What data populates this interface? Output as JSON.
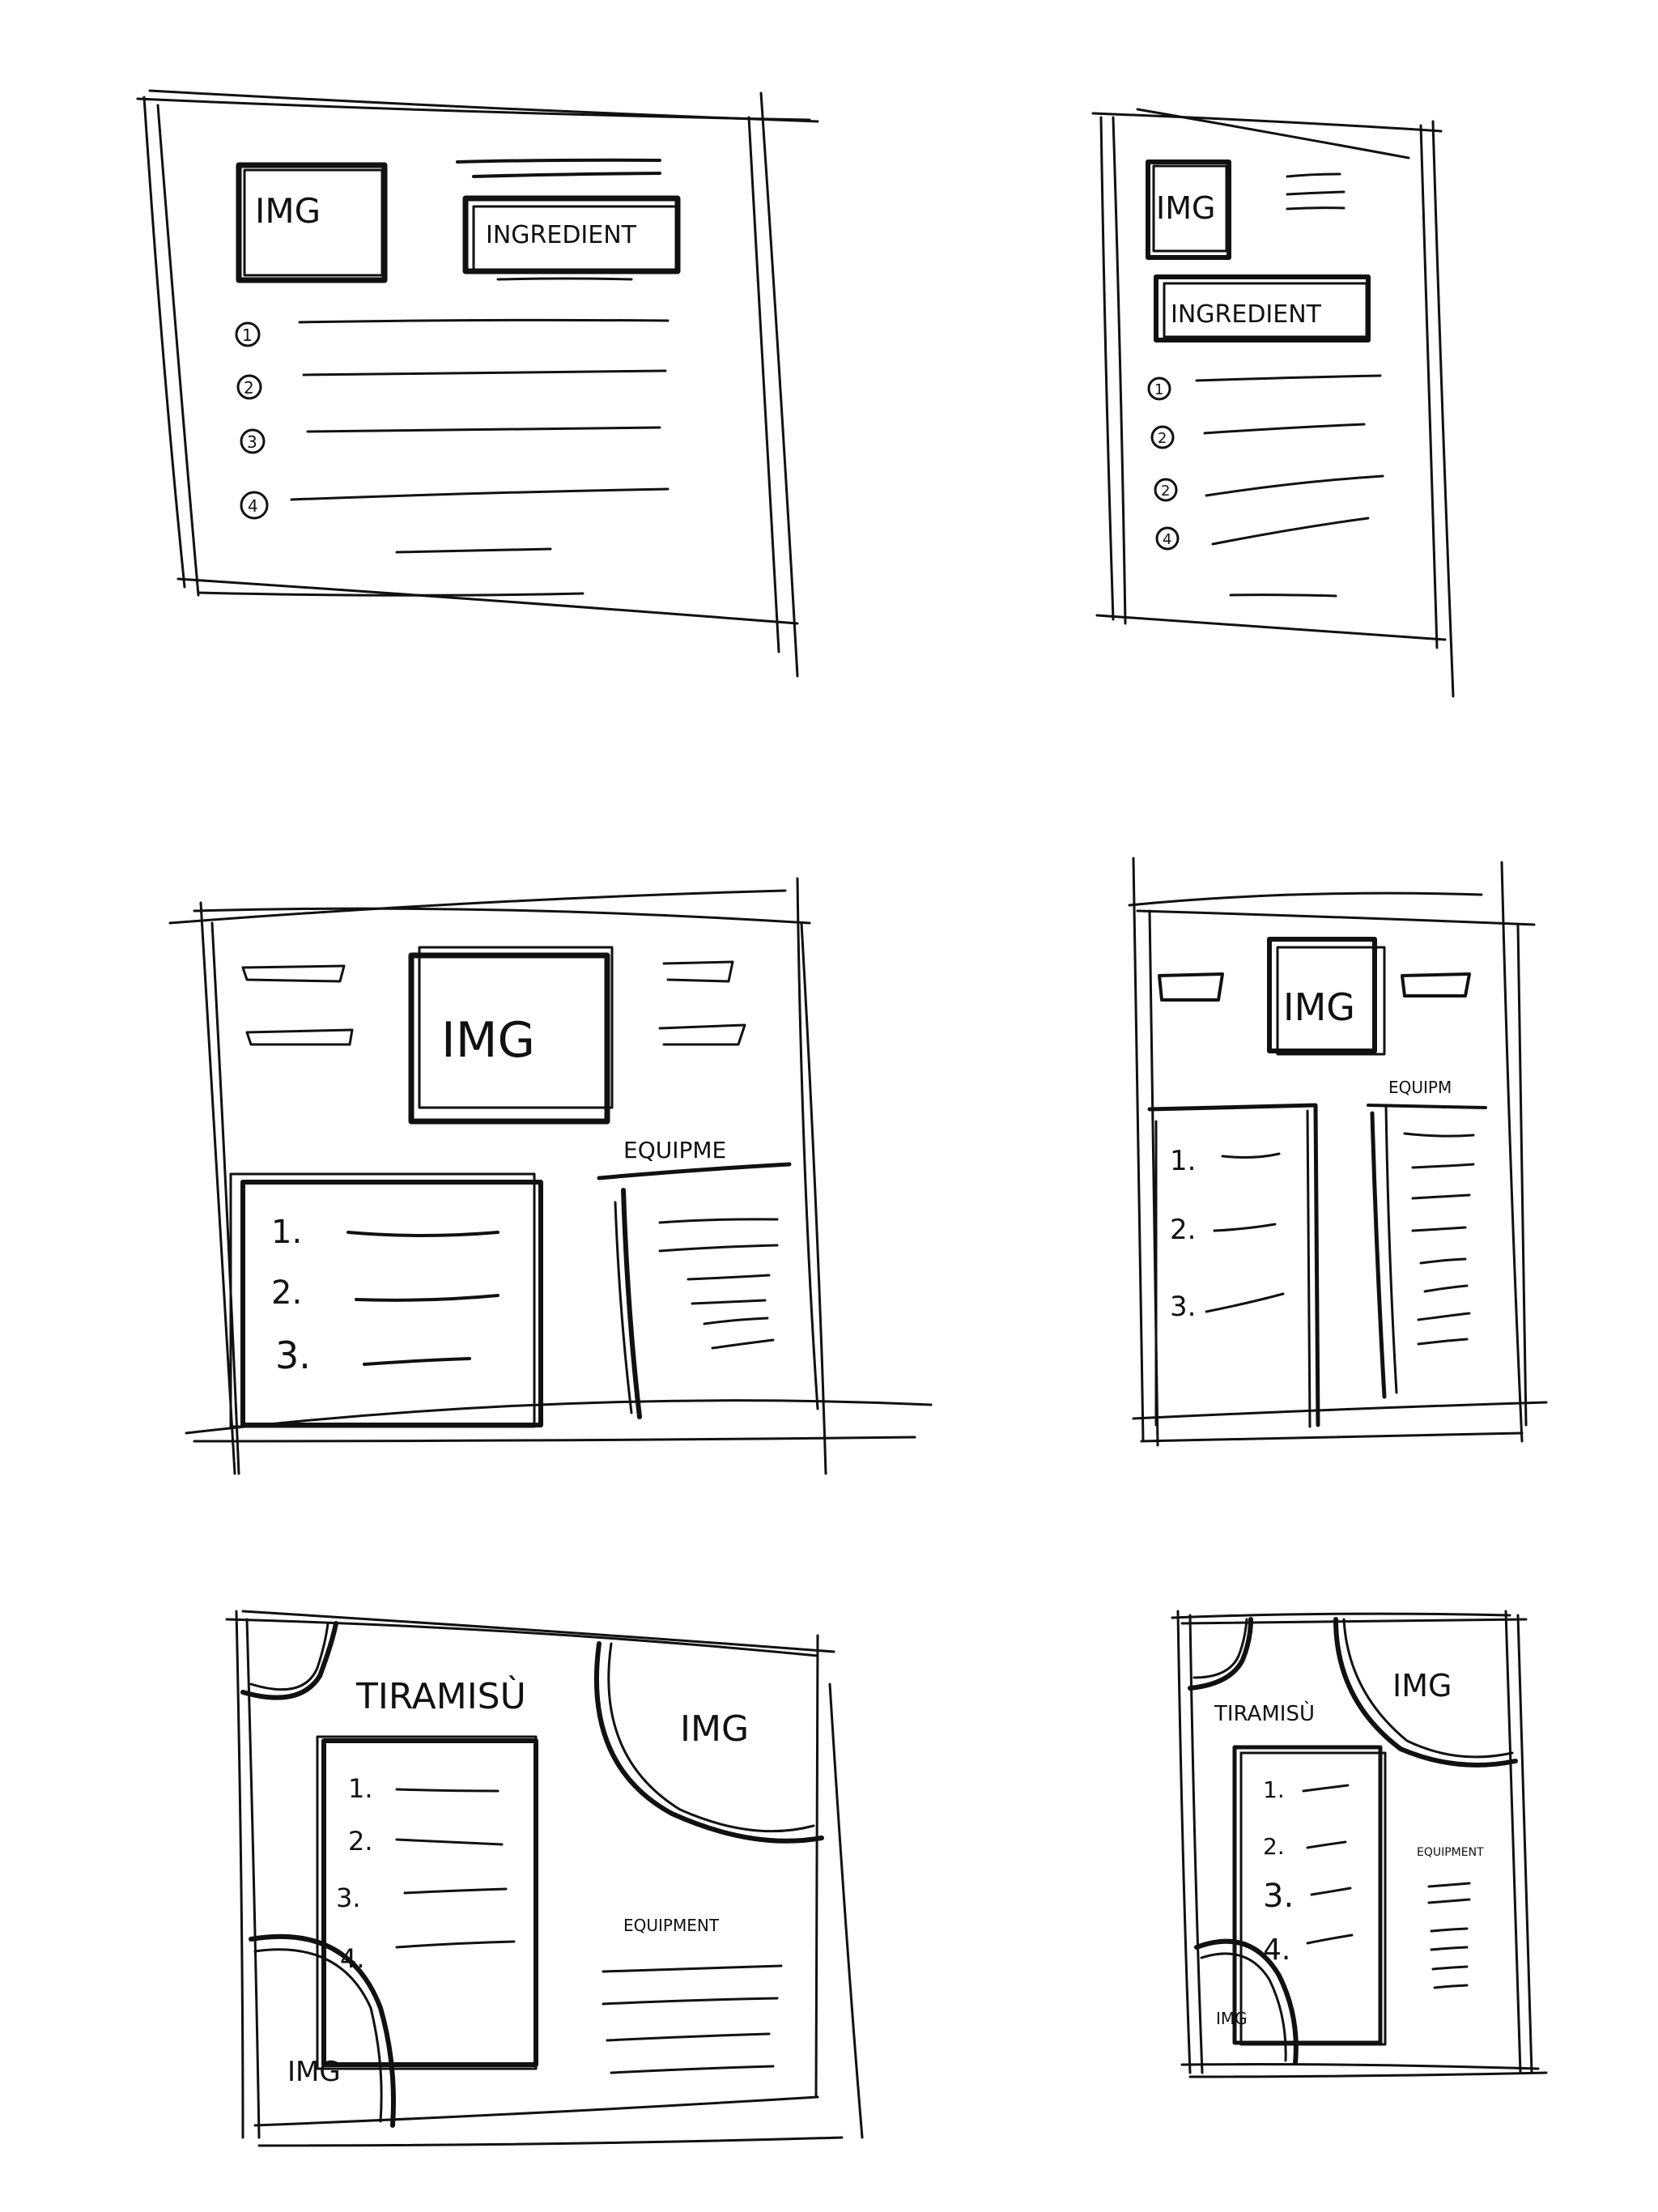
{
  "sketches": [
    {
      "id": "wireframe-1",
      "texts": {
        "img": "IMG",
        "ingredient": "INGREDIENT"
      },
      "steps": [
        "1",
        "2",
        "3",
        "4"
      ]
    },
    {
      "id": "wireframe-2",
      "texts": {
        "img": "IMG",
        "ingredient": "INGREDIENT"
      },
      "steps": [
        "1",
        "2",
        "2",
        "4"
      ]
    },
    {
      "id": "wireframe-3",
      "texts": {
        "img": "IMG",
        "equipment": "EQUIPME"
      },
      "steps": [
        "1.",
        "2.",
        "3."
      ]
    },
    {
      "id": "wireframe-4",
      "texts": {
        "img": "IMG",
        "equipment": "EQUIPM"
      },
      "steps": [
        "1.",
        "2.",
        "3."
      ]
    },
    {
      "id": "wireframe-5",
      "texts": {
        "title": "TIRAMISÙ",
        "img_top": "IMG",
        "img_bottom": "IMG",
        "equipment": "EQUIPMENT"
      },
      "steps": [
        "1.",
        "2.",
        "3.",
        "4."
      ]
    },
    {
      "id": "wireframe-6",
      "texts": {
        "title": "TIRAMISÙ",
        "img_top": "IMG",
        "img_bottom": "IMG",
        "equipment": "EQUIPMENT"
      },
      "steps": [
        "1.",
        "2.",
        "3.",
        "4."
      ]
    }
  ]
}
